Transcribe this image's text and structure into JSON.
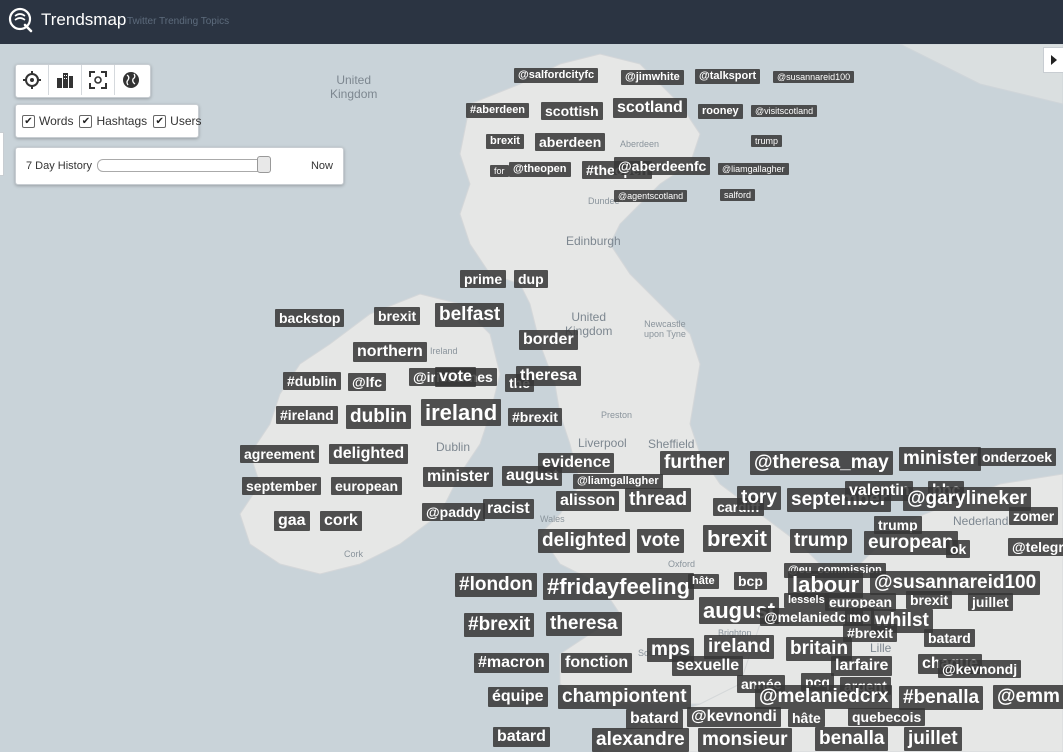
{
  "app": {
    "name": "Trendsmap",
    "tagline": "Twitter Trending Topics"
  },
  "colors": {
    "topbar": "#2b3442",
    "tag_bg": "#363636",
    "sea": "#c9d3d9",
    "land": "#e6e7e6"
  },
  "tools": [
    {
      "icon": "locate-icon"
    },
    {
      "icon": "city-icon"
    },
    {
      "icon": "fullscreen-icon"
    },
    {
      "icon": "globe-icon"
    }
  ],
  "filters": [
    {
      "label": "Words",
      "checked": true
    },
    {
      "label": "Hashtags",
      "checked": true
    },
    {
      "label": "Users",
      "checked": true
    }
  ],
  "history": {
    "label": "7 Day History",
    "end_label": "Now",
    "position": 0.95
  },
  "map_labels": [
    {
      "text": "United\nKingdom",
      "small": false
    },
    {
      "text": "Edinburgh",
      "small": false
    },
    {
      "text": "United\nKingdom",
      "small": false
    },
    {
      "text": "Dublin",
      "small": false
    },
    {
      "text": "Liverpool",
      "small": false
    },
    {
      "text": "Sheffield",
      "small": false
    },
    {
      "text": "Newcastle\nupon Tyne",
      "small": true
    },
    {
      "text": "Aberdeen",
      "small": true
    },
    {
      "text": "Dundee",
      "small": true
    },
    {
      "text": "Preston",
      "small": true
    },
    {
      "text": "Cork",
      "small": true
    },
    {
      "text": "Wales",
      "small": true
    },
    {
      "text": "Oxford",
      "small": true
    },
    {
      "text": "Nederland",
      "small": false
    },
    {
      "text": "Lille",
      "small": false
    },
    {
      "text": "Brighton",
      "small": true
    },
    {
      "text": "Southampton",
      "small": true
    },
    {
      "text": "Ireland",
      "small": true
    }
  ],
  "tags": [
    {
      "text": "@salfordcityfc",
      "s": 2
    },
    {
      "text": "@jimwhite",
      "s": 2
    },
    {
      "text": "@talksport",
      "s": 2
    },
    {
      "text": "@susannareid100",
      "s": 1
    },
    {
      "text": "#aberdeen",
      "s": 2
    },
    {
      "text": "scottish",
      "s": 3
    },
    {
      "text": "scotland",
      "s": 4
    },
    {
      "text": "rooney",
      "s": 2
    },
    {
      "text": "@visitscotland",
      "s": 1
    },
    {
      "text": "brexit",
      "s": 2
    },
    {
      "text": "aberdeen",
      "s": 3
    },
    {
      "text": "trump",
      "s": 1
    },
    {
      "text": "for",
      "s": 1
    },
    {
      "text": "@theopen",
      "s": 2
    },
    {
      "text": "#theopen",
      "s": 3
    },
    {
      "text": "@aberdeenfc",
      "s": 3
    },
    {
      "text": "@liamgallagher",
      "s": 1
    },
    {
      "text": "@agentscotland",
      "s": 1
    },
    {
      "text": "salford",
      "s": 1
    },
    {
      "text": "prime",
      "s": 3
    },
    {
      "text": "dup",
      "s": 3
    },
    {
      "text": "backstop",
      "s": 3
    },
    {
      "text": "brexit",
      "s": 3
    },
    {
      "text": "belfast",
      "s": 5
    },
    {
      "text": "border",
      "s": 4
    },
    {
      "text": "northern",
      "s": 4
    },
    {
      "text": "#dublin",
      "s": 3
    },
    {
      "text": "@lfc",
      "s": 3
    },
    {
      "text": "@irishtimes",
      "s": 3
    },
    {
      "text": "vote",
      "s": 4
    },
    {
      "text": "the",
      "s": 3
    },
    {
      "text": "theresa",
      "s": 4
    },
    {
      "text": "#ireland",
      "s": 3
    },
    {
      "text": "dublin",
      "s": 5
    },
    {
      "text": "ireland",
      "s": 6
    },
    {
      "text": "#brexit",
      "s": 3
    },
    {
      "text": "agreement",
      "s": 3
    },
    {
      "text": "delighted",
      "s": 4
    },
    {
      "text": "september",
      "s": 3
    },
    {
      "text": "european",
      "s": 3
    },
    {
      "text": "minister",
      "s": 4
    },
    {
      "text": "august",
      "s": 4
    },
    {
      "text": "evidence",
      "s": 4
    },
    {
      "text": "@liamgallagher",
      "s": 2
    },
    {
      "text": "gaa",
      "s": 4
    },
    {
      "text": "cork",
      "s": 4
    },
    {
      "text": "@paddy",
      "s": 3
    },
    {
      "text": "racist",
      "s": 4
    },
    {
      "text": "alisson",
      "s": 4
    },
    {
      "text": "thread",
      "s": 5
    },
    {
      "text": "cardiff",
      "s": 3
    },
    {
      "text": "further",
      "s": 5
    },
    {
      "text": "@theresa_may",
      "s": 5
    },
    {
      "text": "minister",
      "s": 5
    },
    {
      "text": "onderzoek",
      "s": 3
    },
    {
      "text": "tory",
      "s": 5
    },
    {
      "text": "september",
      "s": 5
    },
    {
      "text": "valentin",
      "s": 4
    },
    {
      "text": "bbc",
      "s": 4
    },
    {
      "text": "@garylineker",
      "s": 5
    },
    {
      "text": "zomer",
      "s": 3
    },
    {
      "text": "trump",
      "s": 3
    },
    {
      "text": "@telegr",
      "s": 3
    },
    {
      "text": "delighted",
      "s": 5
    },
    {
      "text": "vote",
      "s": 5
    },
    {
      "text": "brexit",
      "s": 6
    },
    {
      "text": "trump",
      "s": 5
    },
    {
      "text": "european",
      "s": 5
    },
    {
      "text": "ok",
      "s": 3
    },
    {
      "text": "@eu_commission",
      "s": 2
    },
    {
      "text": "#london",
      "s": 5
    },
    {
      "text": "#fridayfeeling",
      "s": 6
    },
    {
      "text": "hâte",
      "s": 2
    },
    {
      "text": "bcp",
      "s": 3
    },
    {
      "text": "labour",
      "s": 6
    },
    {
      "text": "@susannareid100",
      "s": 5
    },
    {
      "text": "lessels",
      "s": 2
    },
    {
      "text": "european",
      "s": 3
    },
    {
      "text": "brexit",
      "s": 3
    },
    {
      "text": "juillet",
      "s": 3
    },
    {
      "text": "august",
      "s": 6
    },
    {
      "text": "@melaniedcrx",
      "s": 3
    },
    {
      "text": "mo",
      "s": 3
    },
    {
      "text": "whilst",
      "s": 5
    },
    {
      "text": "#brexit",
      "s": 5
    },
    {
      "text": "theresa",
      "s": 5
    },
    {
      "text": "#brexit",
      "s": 3
    },
    {
      "text": "batard",
      "s": 3
    },
    {
      "text": "#macron",
      "s": 4
    },
    {
      "text": "fonction",
      "s": 4
    },
    {
      "text": "mps",
      "s": 5
    },
    {
      "text": "ireland",
      "s": 5
    },
    {
      "text": "sexuelle",
      "s": 4
    },
    {
      "text": "britain",
      "s": 5
    },
    {
      "text": "larfaire",
      "s": 4
    },
    {
      "text": "chaque",
      "s": 4
    },
    {
      "text": "@kevnondj",
      "s": 3
    },
    {
      "text": "année",
      "s": 3
    },
    {
      "text": "pcq",
      "s": 3
    },
    {
      "text": "argent",
      "s": 3
    },
    {
      "text": "équipe",
      "s": 4
    },
    {
      "text": "championtent",
      "s": 5
    },
    {
      "text": "@melaniedcrx",
      "s": 5
    },
    {
      "text": "#benalla",
      "s": 5
    },
    {
      "text": "@emm",
      "s": 5
    },
    {
      "text": "batard",
      "s": 4
    },
    {
      "text": "@kevnondi",
      "s": 4
    },
    {
      "text": "hâte",
      "s": 3
    },
    {
      "text": "quebecois",
      "s": 3
    },
    {
      "text": "batard",
      "s": 4
    },
    {
      "text": "alexandre",
      "s": 5
    },
    {
      "text": "monsieur",
      "s": 5
    },
    {
      "text": "benalla",
      "s": 5
    },
    {
      "text": "juillet",
      "s": 5
    }
  ]
}
